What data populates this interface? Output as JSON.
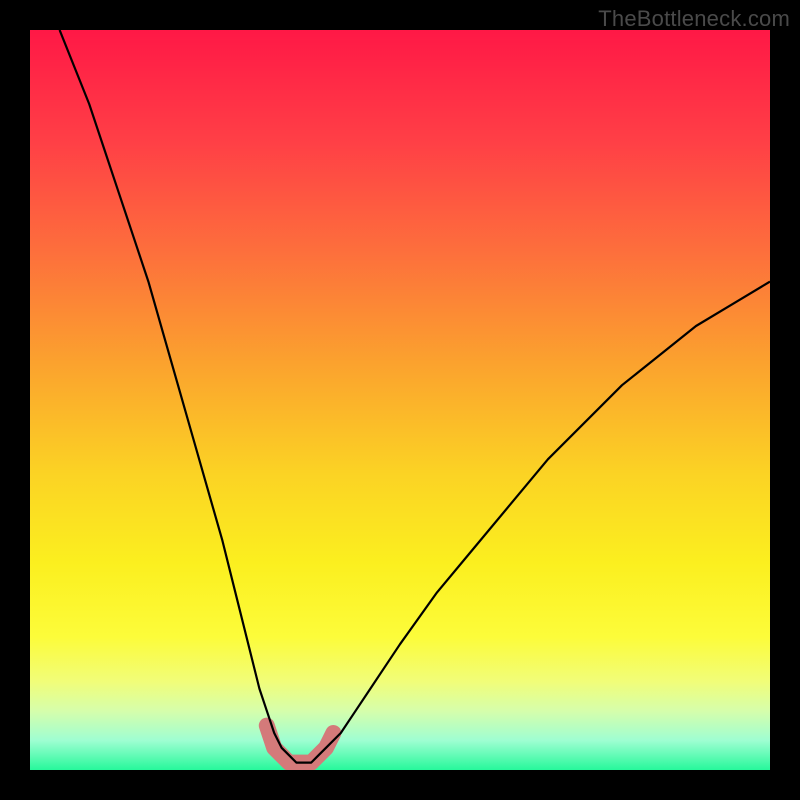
{
  "watermark": {
    "text": "TheBottleneck.com"
  },
  "gradient": {
    "stops": [
      {
        "offset": 0.0,
        "color": "#ff1846"
      },
      {
        "offset": 0.15,
        "color": "#ff3f46"
      },
      {
        "offset": 0.3,
        "color": "#fd6f3c"
      },
      {
        "offset": 0.45,
        "color": "#fba22e"
      },
      {
        "offset": 0.6,
        "color": "#fbd324"
      },
      {
        "offset": 0.72,
        "color": "#fbef1f"
      },
      {
        "offset": 0.82,
        "color": "#fcfc3a"
      },
      {
        "offset": 0.88,
        "color": "#f1fd78"
      },
      {
        "offset": 0.92,
        "color": "#d6feab"
      },
      {
        "offset": 0.96,
        "color": "#9ffed2"
      },
      {
        "offset": 1.0,
        "color": "#27f89b"
      }
    ]
  },
  "curve_styles": {
    "main_stroke": "#000000",
    "main_width": 2.2,
    "marker_stroke": "#d47a7a",
    "marker_width": 16,
    "marker_linecap": "round"
  },
  "chart_data": {
    "type": "line",
    "title": "",
    "xlabel": "",
    "ylabel": "",
    "xlim": [
      0,
      100
    ],
    "ylim": [
      0,
      100
    ],
    "grid": false,
    "legend_position": "none",
    "series": [
      {
        "name": "bottleneck-curve",
        "x": [
          4,
          6,
          8,
          10,
          12,
          14,
          16,
          18,
          20,
          22,
          24,
          26,
          28,
          29,
          30,
          31,
          32,
          33,
          34,
          35,
          36,
          37,
          38,
          39,
          40,
          42,
          44,
          46,
          50,
          55,
          60,
          65,
          70,
          75,
          80,
          85,
          90,
          95,
          100
        ],
        "values": [
          100,
          95,
          90,
          84,
          78,
          72,
          66,
          59,
          52,
          45,
          38,
          31,
          23,
          19,
          15,
          11,
          8,
          5,
          3,
          2,
          1,
          1,
          1,
          2,
          3,
          5,
          8,
          11,
          17,
          24,
          30,
          36,
          42,
          47,
          52,
          56,
          60,
          63,
          66
        ]
      }
    ],
    "annotations": [
      {
        "name": "optimal-range",
        "x": [
          32,
          33,
          34,
          35,
          36,
          37,
          38,
          39,
          40,
          41
        ],
        "values": [
          6,
          3,
          2,
          1,
          1,
          1,
          1,
          2,
          3,
          5
        ]
      }
    ]
  }
}
